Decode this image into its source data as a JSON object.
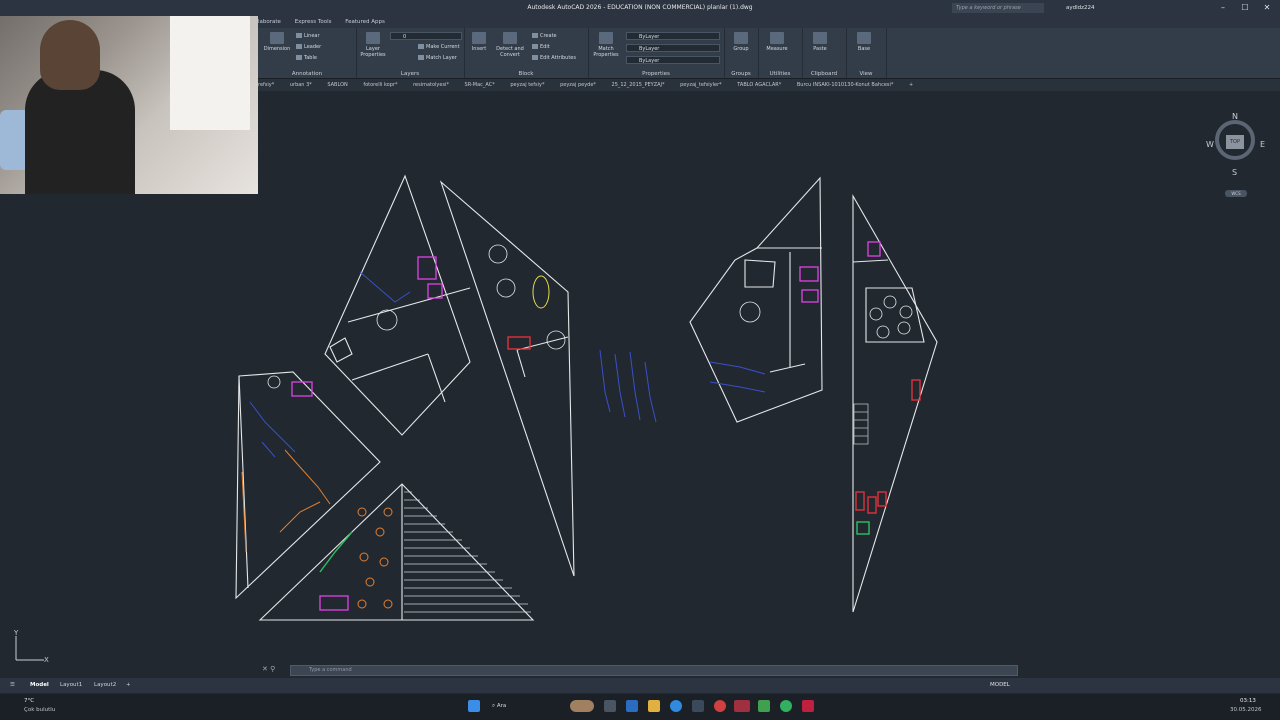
{
  "titlebar": {
    "title": "Autodesk AutoCAD 2026 - EDUCATION (NON COMMERCIAL)   planlar (1).dwg",
    "search_placeholder": "Type a keyword or phrase",
    "user": "aydldz224"
  },
  "ribbon_tabs": [
    "laborate",
    "Express Tools",
    "Featured Apps"
  ],
  "ribbon": {
    "annotation": {
      "title": "Annotation",
      "dimension": "Dimension",
      "linear": "Linear",
      "leader": "Leader",
      "table": "Table"
    },
    "layers": {
      "title": "Layers",
      "layer_properties": "Layer Properties",
      "make_current": "Make Current",
      "match_layer": "Match Layer",
      "layer_value": "0"
    },
    "block": {
      "title": "Block",
      "insert": "Insert",
      "detect": "Detect and Convert",
      "create": "Create",
      "edit": "Edit",
      "edit_attributes": "Edit Attributes"
    },
    "properties": {
      "title": "Properties",
      "match": "Match Properties",
      "color": "ByLayer",
      "linetype": "ByLayer",
      "lineweight": "ByLayer"
    },
    "groups": {
      "title": "Groups",
      "group": "Group"
    },
    "utilities": {
      "title": "Utilities",
      "measure": "Measure"
    },
    "clipboard": {
      "title": "Clipboard",
      "paste": "Paste"
    },
    "view": {
      "title": "View",
      "base": "Base"
    }
  },
  "file_tabs": [
    "refsiy*",
    "urban 3*",
    "SABLON",
    "fotorelli kopr*",
    "resimatolyesi*",
    "SR-Mac_AC*",
    "peyzaj tefsiy*",
    "peyzaj peyde*",
    "25_12_2015_PEYZAJ*",
    "peyzaj_tefsiyler*",
    "TABLO AGACLAR*",
    "Burcu INSAKI-1010130-Konut Bahcesi*"
  ],
  "compass": {
    "n": "N",
    "s": "S",
    "e": "E",
    "w": "W",
    "top": "TOP",
    "wcs": "WCS"
  },
  "ucs": {
    "y": "Y",
    "x": "X"
  },
  "command": {
    "placeholder": "Type a command"
  },
  "status": {
    "layouts": [
      "Model",
      "Layout1",
      "Layout2"
    ],
    "active": "Model",
    "model_label": "MODEL"
  },
  "taskbar": {
    "weather_temp": "7°C",
    "weather_text": "Çok bulutlu",
    "search": "Ara",
    "time": "03:13",
    "date": "30.05.2026"
  },
  "colors": {
    "canvas": "#212830",
    "line": "#e6e8ea",
    "magenta": "#e040e8",
    "orange": "#e08030",
    "blue": "#3a50c8",
    "red": "#e0303a",
    "green": "#30c060"
  }
}
